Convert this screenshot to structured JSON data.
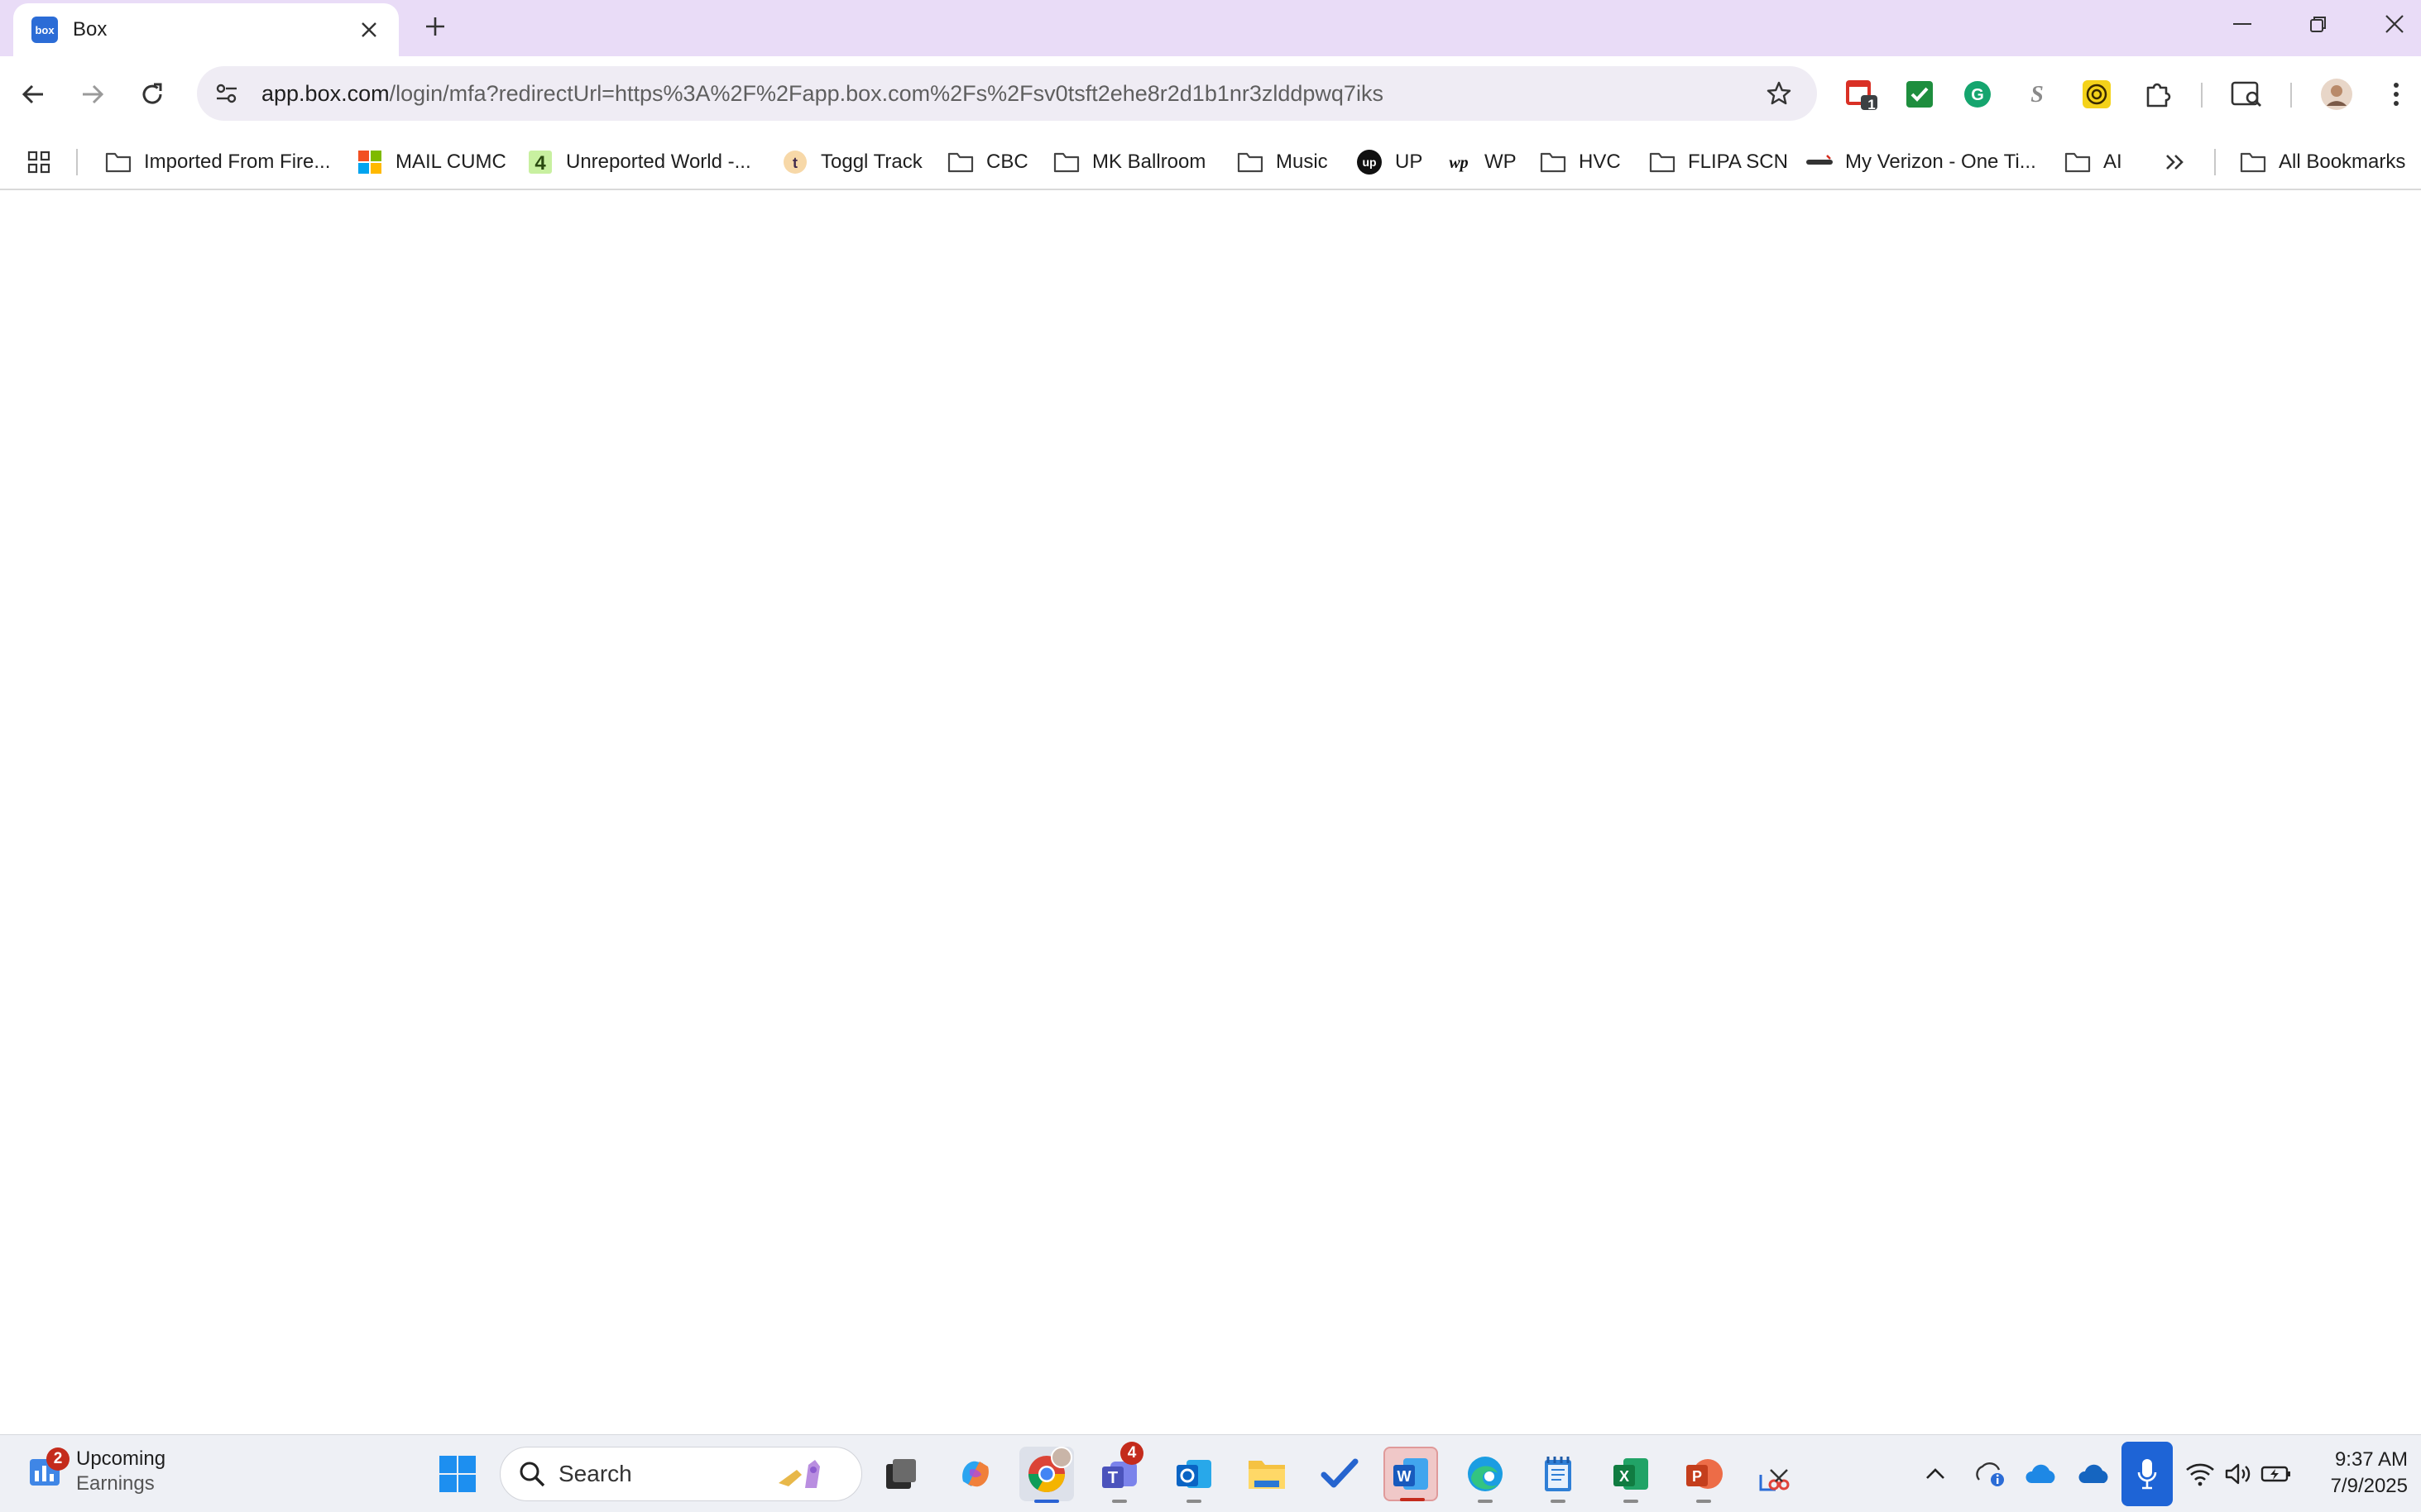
{
  "browser": {
    "tab_title": "Box",
    "favicon_text": "box",
    "url_host": "app.box.com",
    "url_path": "/login/mfa?redirectUrl=https%3A%2F%2Fapp.box.com%2Fs%2Fsv0tsft2ehe8r2d1b1nr3zlddpwq7iks",
    "extension_badge": "1"
  },
  "bookmarks": [
    {
      "label": "Imported From Fire...",
      "icon": "folder-icon"
    },
    {
      "label": "MAIL CUMC",
      "icon": "microsoft-logo-icon"
    },
    {
      "label": "Unreported World -...",
      "icon": "channel4-icon"
    },
    {
      "label": "Toggl Track",
      "icon": "toggl-icon"
    },
    {
      "label": "CBC",
      "icon": "folder-icon"
    },
    {
      "label": "MK Ballroom",
      "icon": "folder-icon"
    },
    {
      "label": "Music",
      "icon": "folder-icon"
    },
    {
      "label": "UP",
      "icon": "upwork-icon"
    },
    {
      "label": "WP",
      "icon": "washington-post-icon"
    },
    {
      "label": "HVC",
      "icon": "folder-icon"
    },
    {
      "label": "FLIPA SCN",
      "icon": "folder-icon"
    },
    {
      "label": "My Verizon - One Ti...",
      "icon": "verizon-icon"
    },
    {
      "label": "AI",
      "icon": "folder-icon"
    }
  ],
  "all_bookmarks_label": "All Bookmarks",
  "taskbar": {
    "widget_badge": "2",
    "widget_title": "Upcoming",
    "widget_subtitle": "Earnings",
    "search_label": "Search",
    "teams_badge": "4",
    "time": "9:37 AM",
    "date": "7/9/2025"
  },
  "colors": {
    "tabstrip": "#e9dcf7",
    "accent_blue": "#1e64d6",
    "badge_red": "#c42b1c"
  }
}
